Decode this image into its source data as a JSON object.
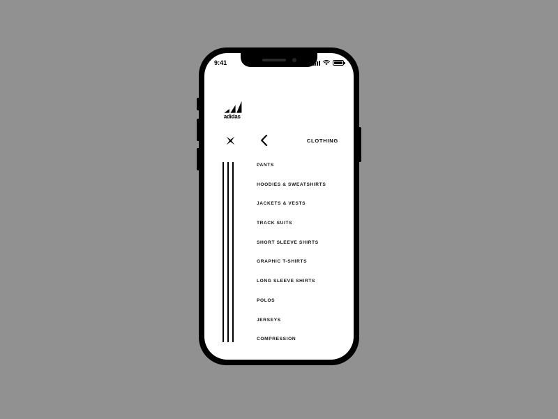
{
  "background_color": "#919191",
  "device": {
    "frame_color": "#000000",
    "screen_background": "#ffffff",
    "buttons": [
      {
        "name": "silent-switch"
      },
      {
        "name": "volume-up-button"
      },
      {
        "name": "volume-down-button"
      },
      {
        "name": "power-button"
      }
    ]
  },
  "status_bar": {
    "time": "9:41",
    "signal_icon": "cellular-signal-icon",
    "signal_bars": 4,
    "wifi_icon": "wifi-icon",
    "battery_icon": "battery-icon",
    "battery_level": 100
  },
  "notch": {
    "speaker_icon": "speaker-slot-icon",
    "camera_icon": "front-camera-icon"
  },
  "header": {
    "logo_name": "adidas-logo",
    "logo_wordmark": "adidas",
    "close_icon": "close-x-icon",
    "back_icon": "chevron-left-icon",
    "title": "CLOTHING"
  },
  "accent": {
    "stripes_icon": "three-stripes-icon",
    "stripe_count": 3,
    "stripe_color": "#000000"
  },
  "menu": {
    "items": [
      {
        "label": "PANTS"
      },
      {
        "label": "HOODIES & SWEATSHIRTS"
      },
      {
        "label": "JACKETS & VESTS"
      },
      {
        "label": "TRACK SUITS"
      },
      {
        "label": "SHORT SLEEVE SHIRTS"
      },
      {
        "label": "GRAPHIC T-SHIRTS"
      },
      {
        "label": "LONG SLEEVE SHIRTS"
      },
      {
        "label": "POLOS"
      },
      {
        "label": "JERSEYS"
      },
      {
        "label": "COMPRESSION"
      }
    ]
  }
}
